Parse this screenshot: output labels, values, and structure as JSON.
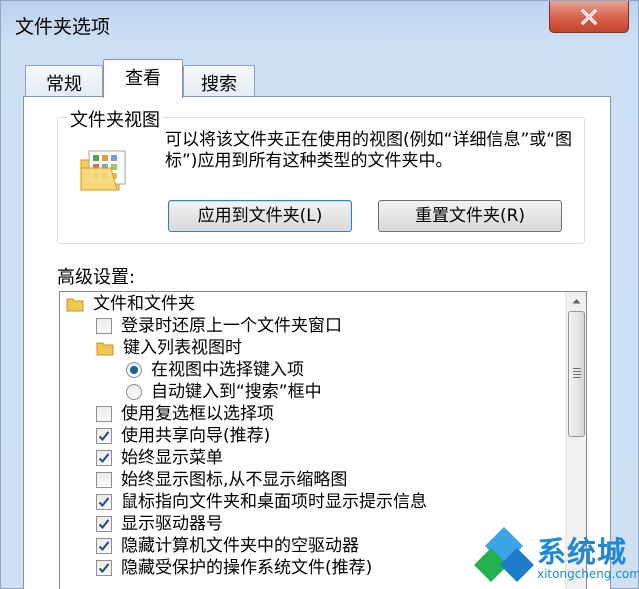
{
  "window": {
    "title": "文件夹选项"
  },
  "tabs": [
    {
      "label": "常规",
      "active": false
    },
    {
      "label": "查看",
      "active": true
    },
    {
      "label": "搜索",
      "active": false
    }
  ],
  "folder_view": {
    "title": "文件夹视图",
    "description": "可以将该文件夹正在使用的视图(例如“详细信息”或“图标”)应用到所有这种类型的文件夹中。",
    "apply_button": "应用到文件夹(L)",
    "reset_button": "重置文件夹(R)"
  },
  "advanced": {
    "label": "高级设置:",
    "items": [
      {
        "kind": "folder",
        "label": "文件和文件夹",
        "indent": 0
      },
      {
        "kind": "checkbox",
        "label": "登录时还原上一个文件夹窗口",
        "checked": false,
        "indent": 1
      },
      {
        "kind": "folder",
        "label": "键入列表视图时",
        "indent": 1
      },
      {
        "kind": "radio",
        "label": "在视图中选择键入项",
        "checked": true,
        "indent": 2
      },
      {
        "kind": "radio",
        "label": "自动键入到“搜索”框中",
        "checked": false,
        "indent": 2
      },
      {
        "kind": "checkbox",
        "label": "使用复选框以选择项",
        "checked": false,
        "indent": 1
      },
      {
        "kind": "checkbox",
        "label": "使用共享向导(推荐)",
        "checked": true,
        "indent": 1
      },
      {
        "kind": "checkbox",
        "label": "始终显示菜单",
        "checked": true,
        "indent": 1
      },
      {
        "kind": "checkbox",
        "label": "始终显示图标,从不显示缩略图",
        "checked": false,
        "indent": 1
      },
      {
        "kind": "checkbox",
        "label": "鼠标指向文件夹和桌面项时显示提示信息",
        "checked": true,
        "indent": 1
      },
      {
        "kind": "checkbox",
        "label": "显示驱动器号",
        "checked": true,
        "indent": 1
      },
      {
        "kind": "checkbox",
        "label": "隐藏计算机文件夹中的空驱动器",
        "checked": true,
        "indent": 1
      },
      {
        "kind": "checkbox",
        "label": "隐藏受保护的操作系统文件(推荐)",
        "checked": true,
        "indent": 1
      }
    ]
  },
  "watermark": {
    "name": "系统城",
    "url": "xitongcheng.com"
  },
  "colors": {
    "accent": "#1e88d7",
    "close": "#c4432b",
    "check": "#1d4a8f"
  }
}
